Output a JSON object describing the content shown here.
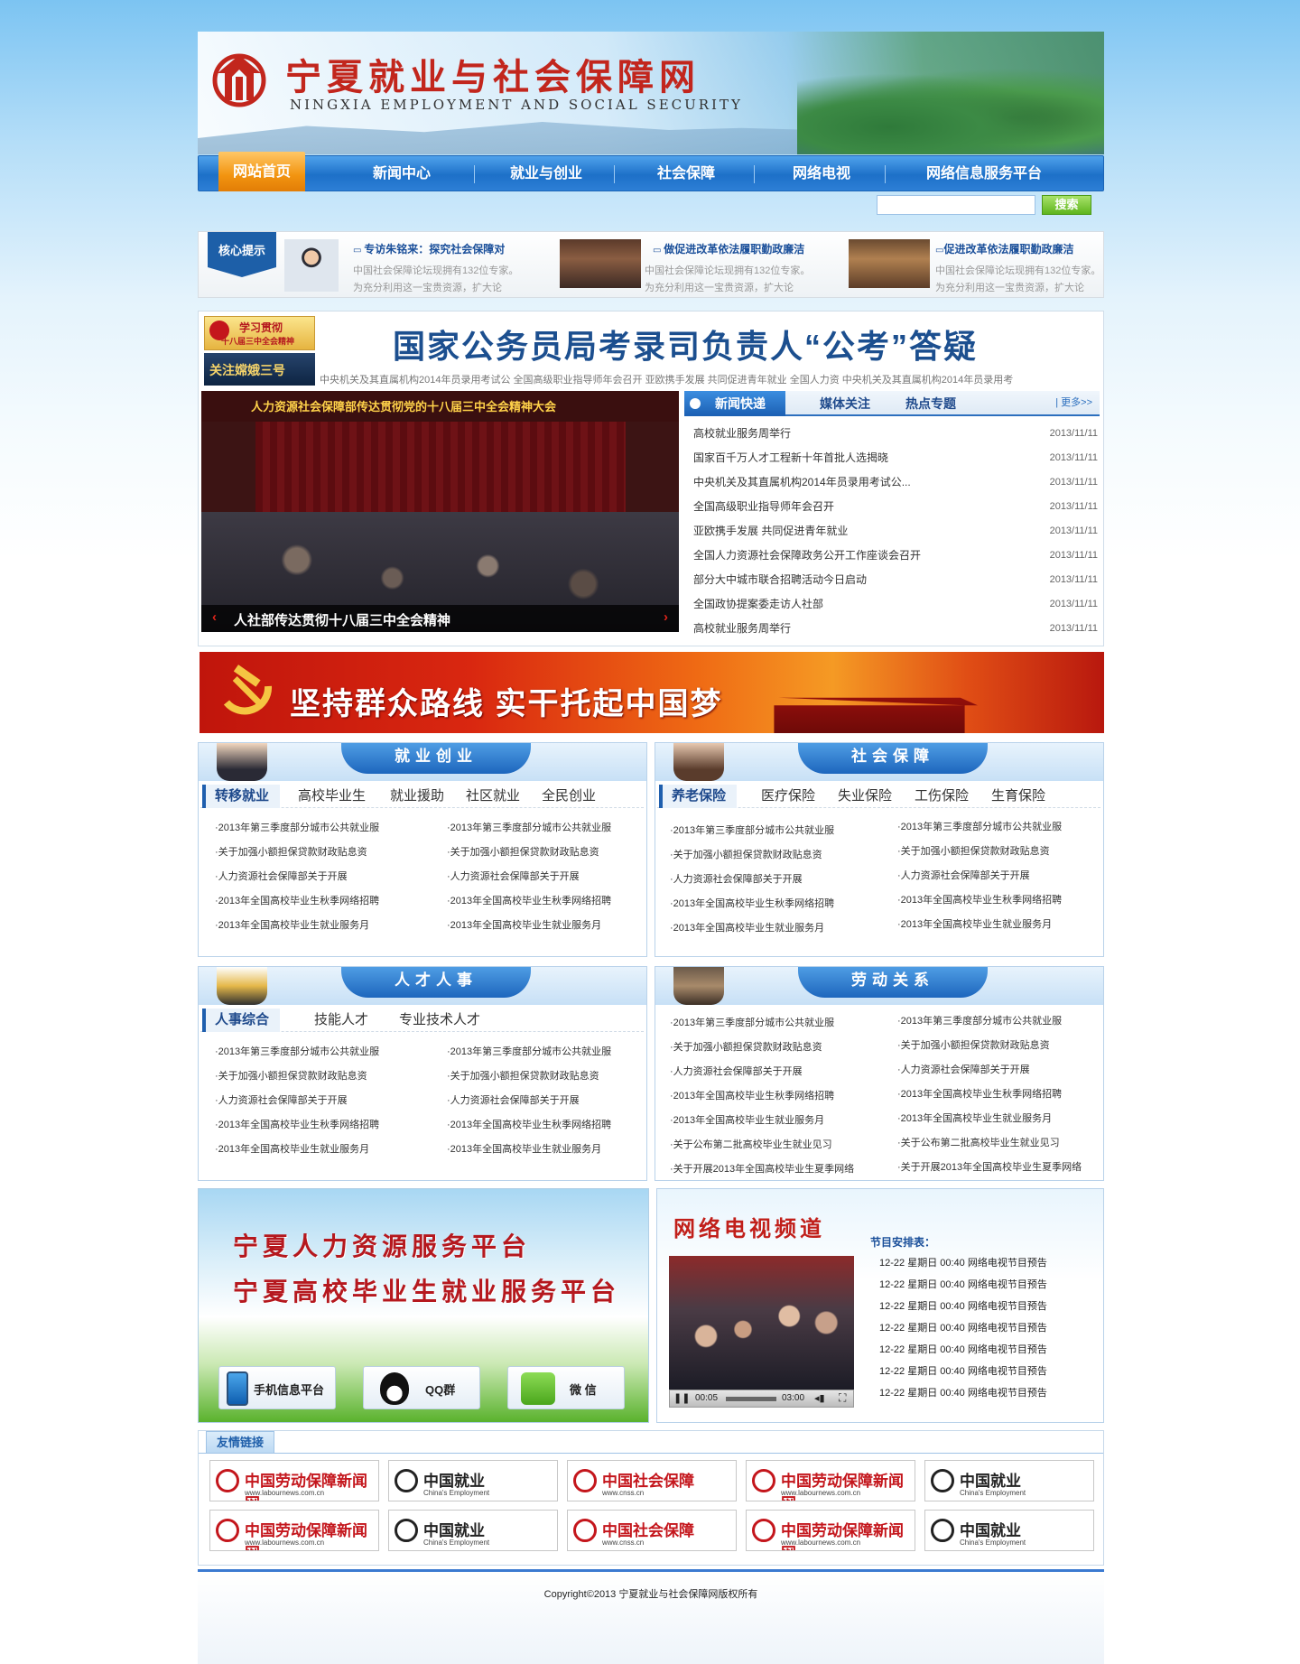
{
  "site": {
    "title": "宁夏就业与社会保障网",
    "subtitle": "NINGXIA EMPLOYMENT AND SOCIAL SECURITY"
  },
  "nav": {
    "items": [
      "网站首页",
      "新闻中心",
      "就业与创业",
      "社会保障",
      "网络电视",
      "网络信息服务平台"
    ],
    "active": "网站首页"
  },
  "search": {
    "placeholder": "",
    "button": "搜索"
  },
  "tips": {
    "badge": "核心提示",
    "items": [
      {
        "title": "专访朱铭来：探究社会保障对",
        "desc": "中国社会保障论坛现拥有132位专家。为充分利用这一宝贵资源，扩大论"
      },
      {
        "title": "做促进改革依法履职勤政廉洁",
        "desc": "中国社会保障论坛现拥有132位专家。为充分利用这一宝贵资源，扩大论"
      },
      {
        "title": "促进改革依法履职勤政廉洁",
        "desc": "中国社会保障论坛现拥有132位专家。为充分利用这一宝贵资源，扩大论"
      }
    ]
  },
  "headline": {
    "text": "国家公务员局考录司负责人“公考”答疑",
    "ticker": "中央机关及其直属机构2014年员录用考试公  全国高级职业指导师年会召开    亚欧携手发展  共同促进青年就业  全国人力资  中央机关及其直属机构2014年员录用考"
  },
  "promos": {
    "study_line1": "学习贯彻",
    "study_line2": "十八届三中全会精神",
    "shenzhou": "关注嫦娥三号"
  },
  "slide": {
    "banner": "人力资源社会保障部传达贯彻党的十八届三中全会精神大会",
    "caption": "人社部传达贯彻十八届三中全会精神"
  },
  "news": {
    "tabs": [
      "新闻快递",
      "媒体关注",
      "热点专题"
    ],
    "more": "| 更多>>",
    "rows": [
      {
        "title": "高校就业服务周举行",
        "date": "2013/11/11"
      },
      {
        "title": "国家百千万人才工程新十年首批人选揭晓",
        "date": "2013/11/11"
      },
      {
        "title": "中央机关及其直属机构2014年员录用考试公...",
        "date": "2013/11/11"
      },
      {
        "title": "全国高级职业指导师年会召开",
        "date": "2013/11/11"
      },
      {
        "title": "亚欧携手发展  共同促进青年就业",
        "date": "2013/11/11"
      },
      {
        "title": "全国人力资源社会保障政务公开工作座谈会召开",
        "date": "2013/11/11"
      },
      {
        "title": "部分大中城市联合招聘活动今日启动",
        "date": "2013/11/11"
      },
      {
        "title": "全国政协提案委走访人社部",
        "date": "2013/11/11"
      },
      {
        "title": "高校就业服务周举行",
        "date": "2013/11/11"
      }
    ]
  },
  "party_banner": {
    "slogan": "坚持群众路线    实干托起中国梦"
  },
  "panels": {
    "jiuye": {
      "title": "就业创业",
      "tabs": [
        "转移就业",
        "高校毕业生",
        "就业援助",
        "社区就业",
        "全民创业"
      ],
      "left": [
        "·2013年第三季度部分城市公共就业服",
        "·关于加强小额担保贷款财政贴息资",
        "·人力资源社会保障部关于开展",
        "·2013年全国高校毕业生秋季网络招聘",
        "·2013年全国高校毕业生就业服务月"
      ],
      "right": [
        "·2013年第三季度部分城市公共就业服",
        "·关于加强小额担保贷款财政贴息资",
        "·人力资源社会保障部关于开展",
        "·2013年全国高校毕业生秋季网络招聘",
        "·2013年全国高校毕业生就业服务月"
      ]
    },
    "shebao": {
      "title": "社会保障",
      "tabs": [
        "养老保险",
        "医疗保险",
        "失业保险",
        "工伤保险",
        "生育保险"
      ],
      "left": [
        "·2013年第三季度部分城市公共就业服",
        "·关于加强小额担保贷款财政贴息资",
        "·人力资源社会保障部关于开展",
        "·2013年全国高校毕业生秋季网络招聘",
        "·2013年全国高校毕业生就业服务月"
      ],
      "right": [
        "·2013年第三季度部分城市公共就业服",
        "·关于加强小额担保贷款财政贴息资",
        "·人力资源社会保障部关于开展",
        "·2013年全国高校毕业生秋季网络招聘",
        "·2013年全国高校毕业生就业服务月"
      ]
    },
    "rencai": {
      "title": "人才人事",
      "tabs": [
        "人事综合",
        "技能人才",
        "专业技术人才"
      ],
      "left": [
        "·2013年第三季度部分城市公共就业服",
        "·关于加强小额担保贷款财政贴息资",
        "·人力资源社会保障部关于开展",
        "·2013年全国高校毕业生秋季网络招聘",
        "·2013年全国高校毕业生就业服务月"
      ],
      "right": [
        "·2013年第三季度部分城市公共就业服",
        "·关于加强小额担保贷款财政贴息资",
        "·人力资源社会保障部关于开展",
        "·2013年全国高校毕业生秋季网络招聘",
        "·2013年全国高校毕业生就业服务月"
      ]
    },
    "laodong": {
      "title": "劳动关系",
      "left": [
        "·2013年第三季度部分城市公共就业服",
        "·关于加强小额担保贷款财政贴息资",
        "·人力资源社会保障部关于开展",
        "·2013年全国高校毕业生秋季网络招聘",
        "·2013年全国高校毕业生就业服务月",
        "·关于公布第二批高校毕业生就业见习",
        "·关于开展2013年全国高校毕业生夏季网络"
      ],
      "right": [
        "·2013年第三季度部分城市公共就业服",
        "·关于加强小额担保贷款财政贴息资",
        "·人力资源社会保障部关于开展",
        "·2013年全国高校毕业生秋季网络招聘",
        "·2013年全国高校毕业生就业服务月",
        "·关于公布第二批高校毕业生就业见习",
        "·关于开展2013年全国高校毕业生夏季网络"
      ]
    }
  },
  "platform": {
    "line1": "宁夏人力资源服务平台",
    "line2": "宁夏高校毕业生就业服务平台",
    "buttons": [
      "手机信息平台",
      "QQ群",
      "微 信"
    ]
  },
  "tv": {
    "title": "网络电视频道",
    "schedule_label": "节目安排表：",
    "time_current": "00:05",
    "time_total": "03:00",
    "schedule": [
      "12-22  星期日   00:40  网络电视节目预告",
      "12-22  星期日   00:40  网络电视节目预告",
      "12-22  星期日   00:40  网络电视节目预告",
      "12-22  星期日   00:40  网络电视节目预告",
      "12-22  星期日   00:40  网络电视节目预告",
      "12-22  星期日   00:40  网络电视节目预告",
      "12-22  星期日   00:40  网络电视节目预告"
    ]
  },
  "friends": {
    "label": "友情链接",
    "links": [
      {
        "name": "中国劳动保障新闻网",
        "url": "www.labournews.com.cn",
        "color": "#c4161c"
      },
      {
        "name": "中国就业",
        "url": "China's Employment",
        "color": "#222222"
      },
      {
        "name": "中国社会保障",
        "url": "www.cnss.cn",
        "color": "#c4161c"
      },
      {
        "name": "中国劳动保障新闻网",
        "url": "www.labournews.com.cn",
        "color": "#c4161c"
      },
      {
        "name": "中国就业",
        "url": "China's Employment",
        "color": "#222222"
      },
      {
        "name": "中国劳动保障新闻网",
        "url": "www.labournews.com.cn",
        "color": "#c4161c"
      },
      {
        "name": "中国就业",
        "url": "China's Employment",
        "color": "#222222"
      },
      {
        "name": "中国社会保障",
        "url": "www.cnss.cn",
        "color": "#c4161c"
      },
      {
        "name": "中国劳动保障新闻网",
        "url": "www.labournews.com.cn",
        "color": "#c4161c"
      },
      {
        "name": "中国就业",
        "url": "China's Employment",
        "color": "#222222"
      }
    ]
  },
  "footer": {
    "copyright": "Copyright©2013  宁夏就业与社会保障网版权所有"
  }
}
